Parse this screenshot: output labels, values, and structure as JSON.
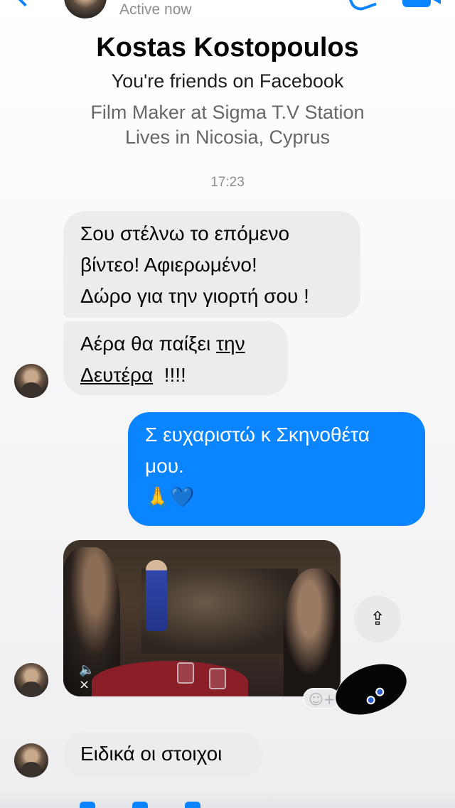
{
  "header": {
    "status": "Active now"
  },
  "profile": {
    "name": "Kostas Kostopoulos",
    "friends": "You're friends on Facebook",
    "work": "Film Maker at Sigma T.V Station",
    "lives": "Lives in Nicosia, Cyprus"
  },
  "thread": {
    "timestamp": "17:23",
    "messages": [
      {
        "direction": "incoming",
        "lines": [
          "Σου στέλνω το επόμενο",
          "βίντεο! Αφιερωμένο!",
          "Δώρο για την γιορτή σου !"
        ]
      },
      {
        "direction": "incoming",
        "parts": [
          "Αέρα θα παίξει ",
          "την",
          "Δευτέρα",
          "  !!!!"
        ]
      },
      {
        "direction": "outgoing",
        "lines": [
          "Σ ευχαριστώ κ Σκηνοθέτα",
          "μου.",
          "🙏💙"
        ]
      },
      {
        "direction": "incoming",
        "type": "video",
        "muted": true
      },
      {
        "direction": "incoming",
        "text": "Ειδικά οι στοιχοι"
      }
    ]
  },
  "icons": {
    "mute": "🔈×",
    "share": "⇪",
    "add_reaction": "☺+"
  },
  "colors": {
    "accent": "#0a84ff",
    "incoming_bubble": "#ececee",
    "secondary_text": "#65676b"
  }
}
